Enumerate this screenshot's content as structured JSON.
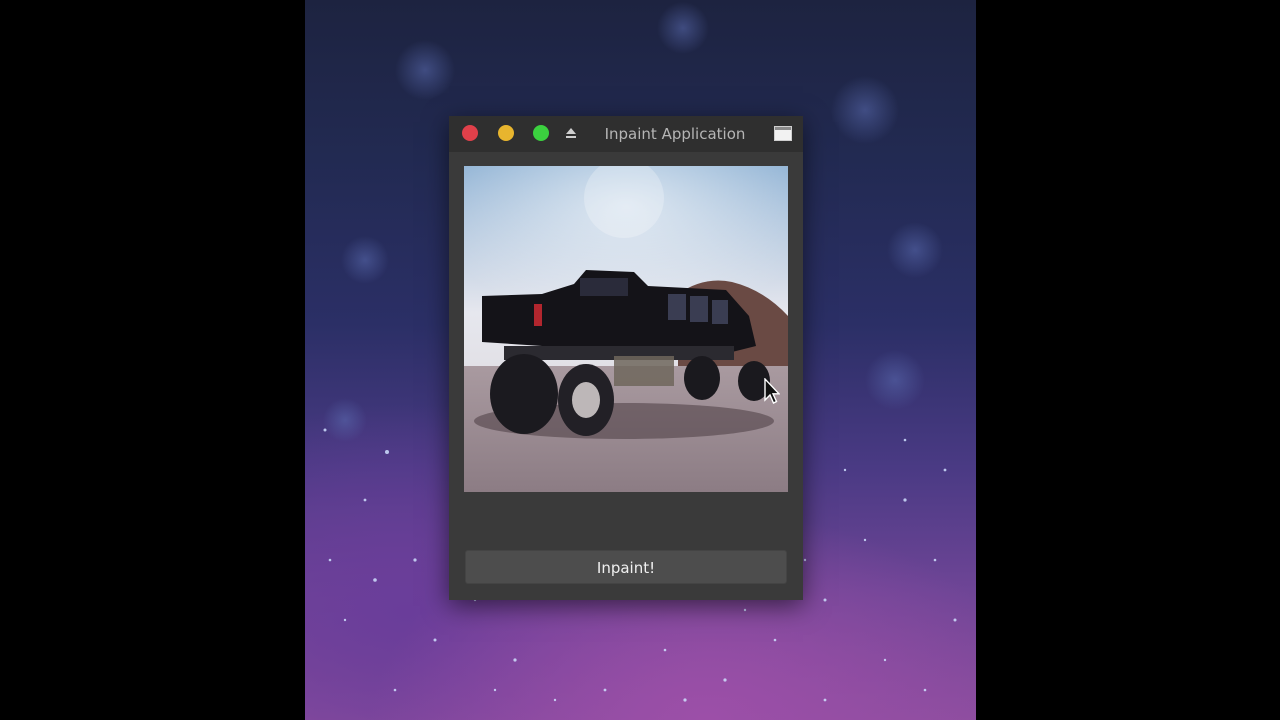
{
  "window": {
    "title": "Inpaint Application"
  },
  "controls": {
    "close": "close-icon",
    "minimize": "minimize-icon",
    "maximize": "maximize-icon",
    "eject": "eject-icon",
    "restore": "restore-icon"
  },
  "image": {
    "description_icon": "image-canvas"
  },
  "buttons": {
    "inpaint_label": "Inpaint!"
  },
  "colors": {
    "close": "#e0404a",
    "minimize": "#e8b52e",
    "maximize": "#3bd13f",
    "window_bg": "#3a3a3a",
    "titlebar_bg": "#2f2f2f",
    "button_bg": "#4d4d4d"
  }
}
